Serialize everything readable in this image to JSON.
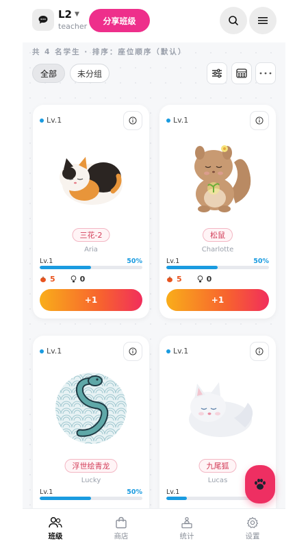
{
  "header": {
    "class_name": "L2",
    "role": "teacher",
    "share_label": "分享班级"
  },
  "summary_text": "共 4 名学生 · 排序：座位顺序（默认）",
  "filters": [
    {
      "label": "全部",
      "active": true
    },
    {
      "label": "未分组",
      "active": false
    }
  ],
  "students": [
    {
      "level_tag": "Lv.1",
      "pet_name": "三花-2",
      "student": "Aria",
      "level": "Lv.1",
      "progress": "50%",
      "progress_value": 0.5,
      "food": "5",
      "ideas": "0",
      "action": "+1",
      "pet_icon": "calico-cat"
    },
    {
      "level_tag": "Lv.1",
      "pet_name": "松鼠",
      "student": "Charlotte",
      "level": "Lv.1",
      "progress": "50%",
      "progress_value": 0.5,
      "food": "5",
      "ideas": "0",
      "action": "+1",
      "pet_icon": "squirrel"
    },
    {
      "level_tag": "Lv.1",
      "pet_name": "浮世绘青龙",
      "student": "Lucky",
      "level": "Lv.1",
      "progress": "50%",
      "progress_value": 0.5,
      "food": "",
      "ideas": "",
      "action": "",
      "pet_icon": "ukiyoe-dragon"
    },
    {
      "level_tag": "Lv.1",
      "pet_name": "九尾狐",
      "student": "Lucas",
      "level": "Lv.1",
      "progress": "",
      "progress_value": 0.2,
      "food": "",
      "ideas": "",
      "action": "",
      "pet_icon": "white-fox"
    }
  ],
  "nav": [
    {
      "label": "班级",
      "icon": "users-icon",
      "active": true
    },
    {
      "label": "商店",
      "icon": "shopping-bag-icon",
      "active": false
    },
    {
      "label": "统计",
      "icon": "podium-icon",
      "active": false
    },
    {
      "label": "设置",
      "icon": "gear-icon",
      "active": false
    }
  ],
  "colors": {
    "accent_pink": "#ee2f8b",
    "progress_blue": "#1a9be0",
    "button_gradient_start": "#f9ad1a",
    "button_gradient_end": "#f12e5c",
    "fab": "#ee2f62"
  }
}
